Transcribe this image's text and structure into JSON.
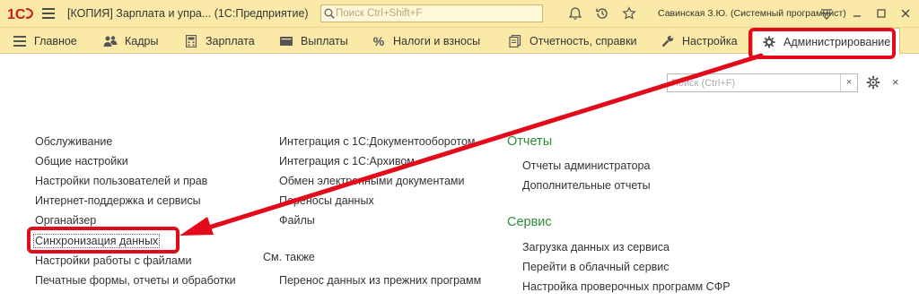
{
  "window": {
    "title": "[КОПИЯ] Зарплата и упра... (1С:Предприятие)",
    "search_placeholder": "Поиск Ctrl+Shift+F",
    "user": "Савинская З.Ю. (Системный программист)"
  },
  "menu": {
    "items": [
      {
        "label": "Главное",
        "icon": "hamburger-icon"
      },
      {
        "label": "Кадры",
        "icon": "people-icon"
      },
      {
        "label": "Зарплата",
        "icon": "calculator-icon"
      },
      {
        "label": "Выплаты",
        "icon": "wallet-icon"
      },
      {
        "label": "Налоги и взносы",
        "icon": "percent-icon"
      },
      {
        "label": "Отчетность, справки",
        "icon": "documents-icon"
      },
      {
        "label": "Настройка",
        "icon": "wrench-icon"
      },
      {
        "label": "Администрирование",
        "icon": "gear-icon",
        "active": true
      }
    ]
  },
  "panel": {
    "search_placeholder": "Поиск (Ctrl+F)",
    "clear_label": "×",
    "close_label": "×"
  },
  "column1": {
    "links": [
      "Обслуживание",
      "Общие настройки",
      "Настройки пользователей и прав",
      "Интернет-поддержка и сервисы",
      "Органайзер",
      "Синхронизация данных",
      "Настройки работы с файлами",
      "Печатные формы, отчеты и обработки"
    ]
  },
  "column2": {
    "links": [
      "Интеграция с 1С:Документооборотом",
      "Интеграция с 1С:Архивом",
      "Обмен электронными документами",
      "Переносы данных",
      "Файлы"
    ],
    "see_also_label": "См. также",
    "see_also_links": [
      "Перенос данных из прежних программ"
    ]
  },
  "column3": {
    "reports_heading": "Отчеты",
    "reports_links": [
      "Отчеты администратора",
      "Дополнительные отчеты"
    ],
    "service_heading": "Сервис",
    "service_links": [
      "Загрузка данных из сервиса",
      "Перейти в облачный сервис",
      "Настройка проверочных программ СФР"
    ]
  },
  "colors": {
    "titlebar_bg": "#fbeaa7",
    "section_heading": "#2e8b3a",
    "annotation_red": "#e30b1b"
  }
}
